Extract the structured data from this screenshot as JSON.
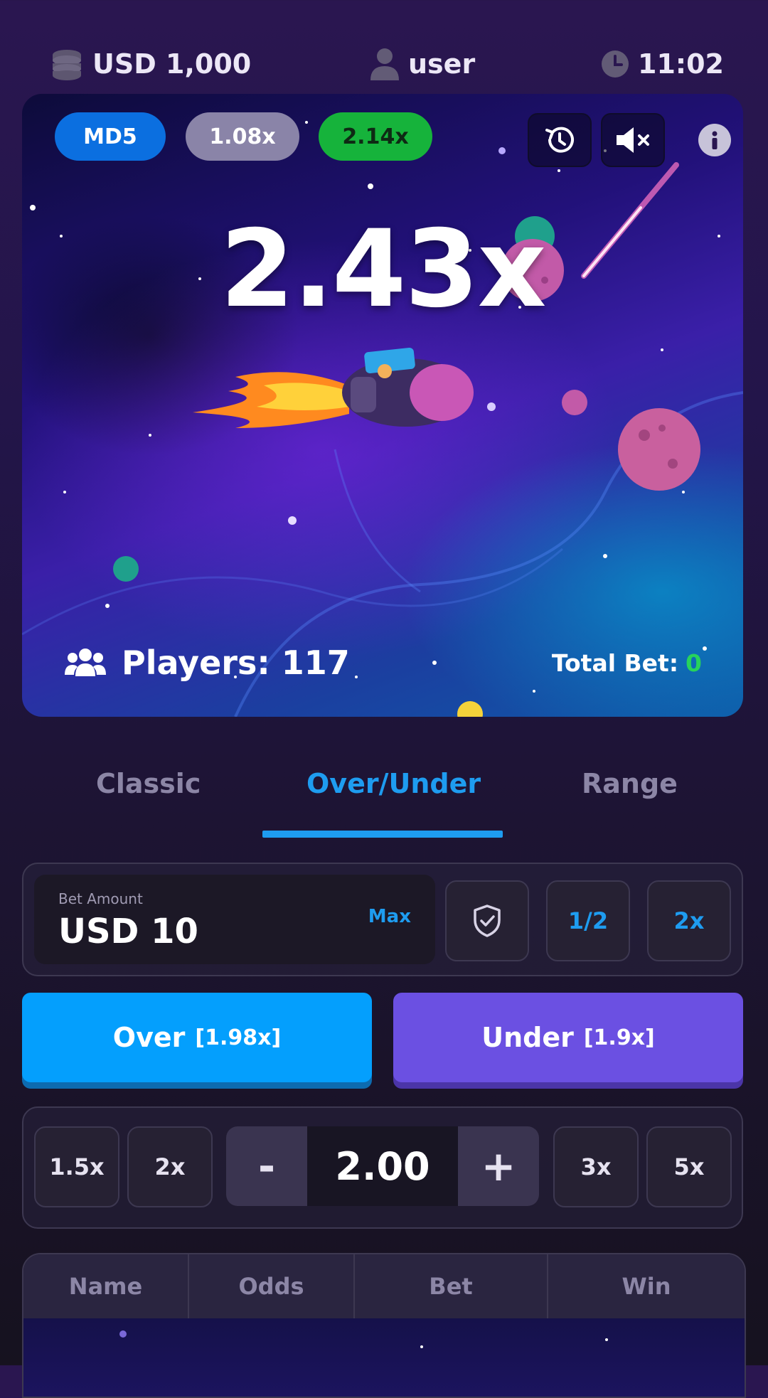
{
  "header": {
    "balance": "USD 1,000",
    "username": "user",
    "time": "11:02"
  },
  "game": {
    "seed_badge": "MD5",
    "history_badges": [
      "1.08x",
      "2.14x"
    ],
    "multiplier": "2.43x",
    "players_label": "Players: 117",
    "total_bet_label": "Total Bet:",
    "total_bet_value": "0"
  },
  "tabs": [
    {
      "label": "Classic",
      "active": false
    },
    {
      "label": "Over/Under",
      "active": true
    },
    {
      "label": "Range",
      "active": false
    }
  ],
  "bet": {
    "label": "Bet Amount",
    "value": "USD 10",
    "max_label": "Max",
    "half_label": "1/2",
    "double_label": "2x"
  },
  "actions": {
    "over_label": "Over",
    "over_odds": "[1.98x]",
    "under_label": "Under",
    "under_odds": "[1.9x]"
  },
  "target": {
    "presets_left": [
      "1.5x",
      "2x"
    ],
    "presets_right": [
      "3x",
      "5x"
    ],
    "minus": "-",
    "plus": "+",
    "value": "2.00"
  },
  "table": {
    "columns": [
      "Name",
      "Odds",
      "Bet",
      "Win"
    ]
  },
  "colors": {
    "accent_blue": "#049ffd",
    "accent_purple": "#6b50e2",
    "win_green": "#27d35b",
    "history_grey": "#8a84a8",
    "history_green": "#16b33b",
    "seed_blue": "#0b6fe0"
  },
  "icons": {
    "balance": "coin-stack-icon",
    "user": "user-icon",
    "clock": "clock-icon",
    "history": "history-icon",
    "sound": "mute-icon",
    "info": "info-icon",
    "players": "users-icon",
    "shield": "shield-check-icon"
  }
}
